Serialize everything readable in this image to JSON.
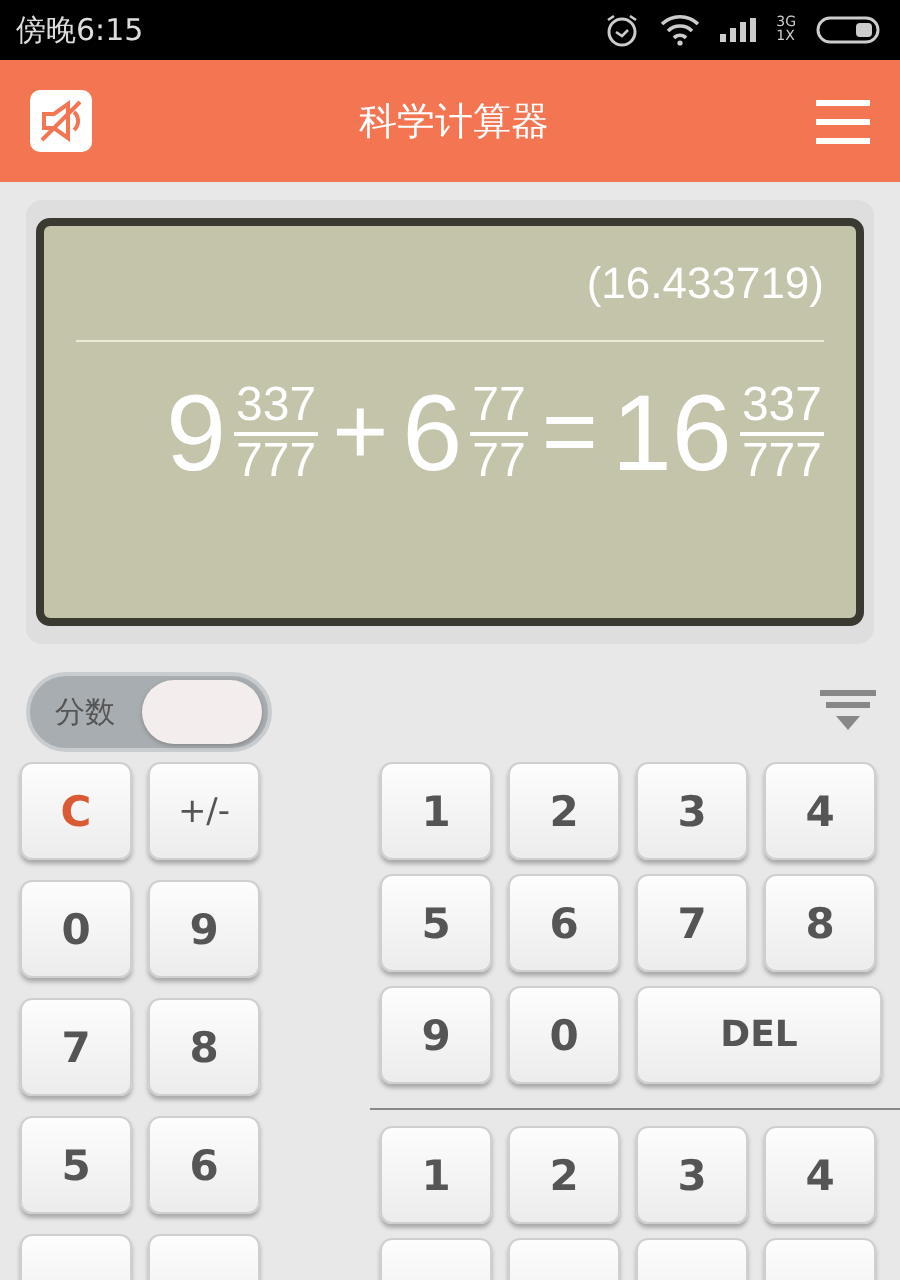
{
  "status_bar": {
    "time": "傍晚6:15",
    "network": "3G",
    "sim": "1X"
  },
  "header": {
    "title": "科学计算器"
  },
  "display": {
    "decimal": "(16.433719)",
    "expression": [
      {
        "kind": "mixed",
        "whole": "9",
        "numerator": "337",
        "denominator": "777"
      },
      {
        "kind": "operator",
        "text": "+"
      },
      {
        "kind": "mixed",
        "whole": "6",
        "numerator": "77",
        "denominator": "77"
      },
      {
        "kind": "operator",
        "text": "="
      },
      {
        "kind": "mixed",
        "whole": "16",
        "numerator": "337",
        "denominator": "777"
      }
    ]
  },
  "fraction_toggle": {
    "label": "分数",
    "on": true
  },
  "left_keys": [
    {
      "label": "C",
      "kind": "clear"
    },
    {
      "label": "+/-",
      "kind": "sign"
    },
    {
      "label": "0",
      "kind": "digit"
    },
    {
      "label": "9",
      "kind": "digit"
    },
    {
      "label": "7",
      "kind": "digit"
    },
    {
      "label": "8",
      "kind": "digit"
    },
    {
      "label": "5",
      "kind": "digit"
    },
    {
      "label": "6",
      "kind": "digit"
    },
    {
      "kind": "digit"
    },
    {
      "kind": "digit"
    }
  ],
  "right_key_groups": [
    [
      {
        "label": "1",
        "kind": "digit"
      },
      {
        "label": "2",
        "kind": "digit"
      },
      {
        "label": "3",
        "kind": "digit"
      },
      {
        "label": "4",
        "kind": "digit"
      },
      {
        "label": "5",
        "kind": "digit"
      },
      {
        "label": "6",
        "kind": "digit"
      },
      {
        "label": "7",
        "kind": "digit"
      },
      {
        "label": "8",
        "kind": "digit"
      },
      {
        "label": "9",
        "kind": "digit"
      },
      {
        "label": "0",
        "kind": "digit"
      },
      {
        "label": "DEL",
        "kind": "wide"
      }
    ],
    [
      {
        "label": "1",
        "kind": "digit"
      },
      {
        "label": "2",
        "kind": "digit"
      },
      {
        "label": "3",
        "kind": "digit"
      },
      {
        "label": "4",
        "kind": "digit"
      },
      {
        "kind": "digit"
      },
      {
        "kind": "digit"
      },
      {
        "kind": "digit"
      },
      {
        "kind": "digit"
      }
    ]
  ]
}
